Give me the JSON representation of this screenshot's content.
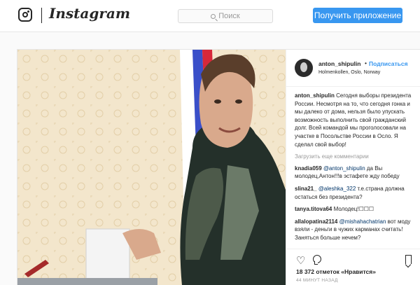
{
  "topbar": {
    "brand": "Instagram",
    "search_placeholder": "Поиск",
    "get_app_label": "Получить приложение"
  },
  "post": {
    "author": "anton_shipulin",
    "follow_label": "Подписаться",
    "location": "Holmenkollen, Oslo, Norway",
    "caption": "Сегодня выборы президента России. Несмотря на то, что сегодня гонка и мы далеко от дома, нельзя было упускать возможность выполнить свой гражданский долг. Всей командой мы проголосовали на участке в Посольстве России в Осло. Я сделал свой выбор!",
    "load_more": "Загрузить еще комментарии",
    "comments": [
      {
        "author": "knadia059",
        "mention": "@anton_shipulin",
        "text": " да Вы молодец,Антон!!!в эстафете жду победу"
      },
      {
        "author": "slina21_",
        "mention": "@aleshka_322",
        "text": " т.е.страна должна остаться без президента?"
      },
      {
        "author": "tanya.titova64",
        "mention": "",
        "text": " Молодец!☐☐☐"
      },
      {
        "author": "allalopatina2114",
        "mention": "@mishahachatrian",
        "text": " вот моду взяли - деньги в чужих карманах считать! Заняться больше нечем?"
      }
    ],
    "likes": "18 372 отметок «Нравится»",
    "time": "44 МИНУТ НАЗАД",
    "icons": {
      "like": "heart-icon",
      "comment": "comment-icon",
      "save": "bookmark-icon"
    }
  }
}
